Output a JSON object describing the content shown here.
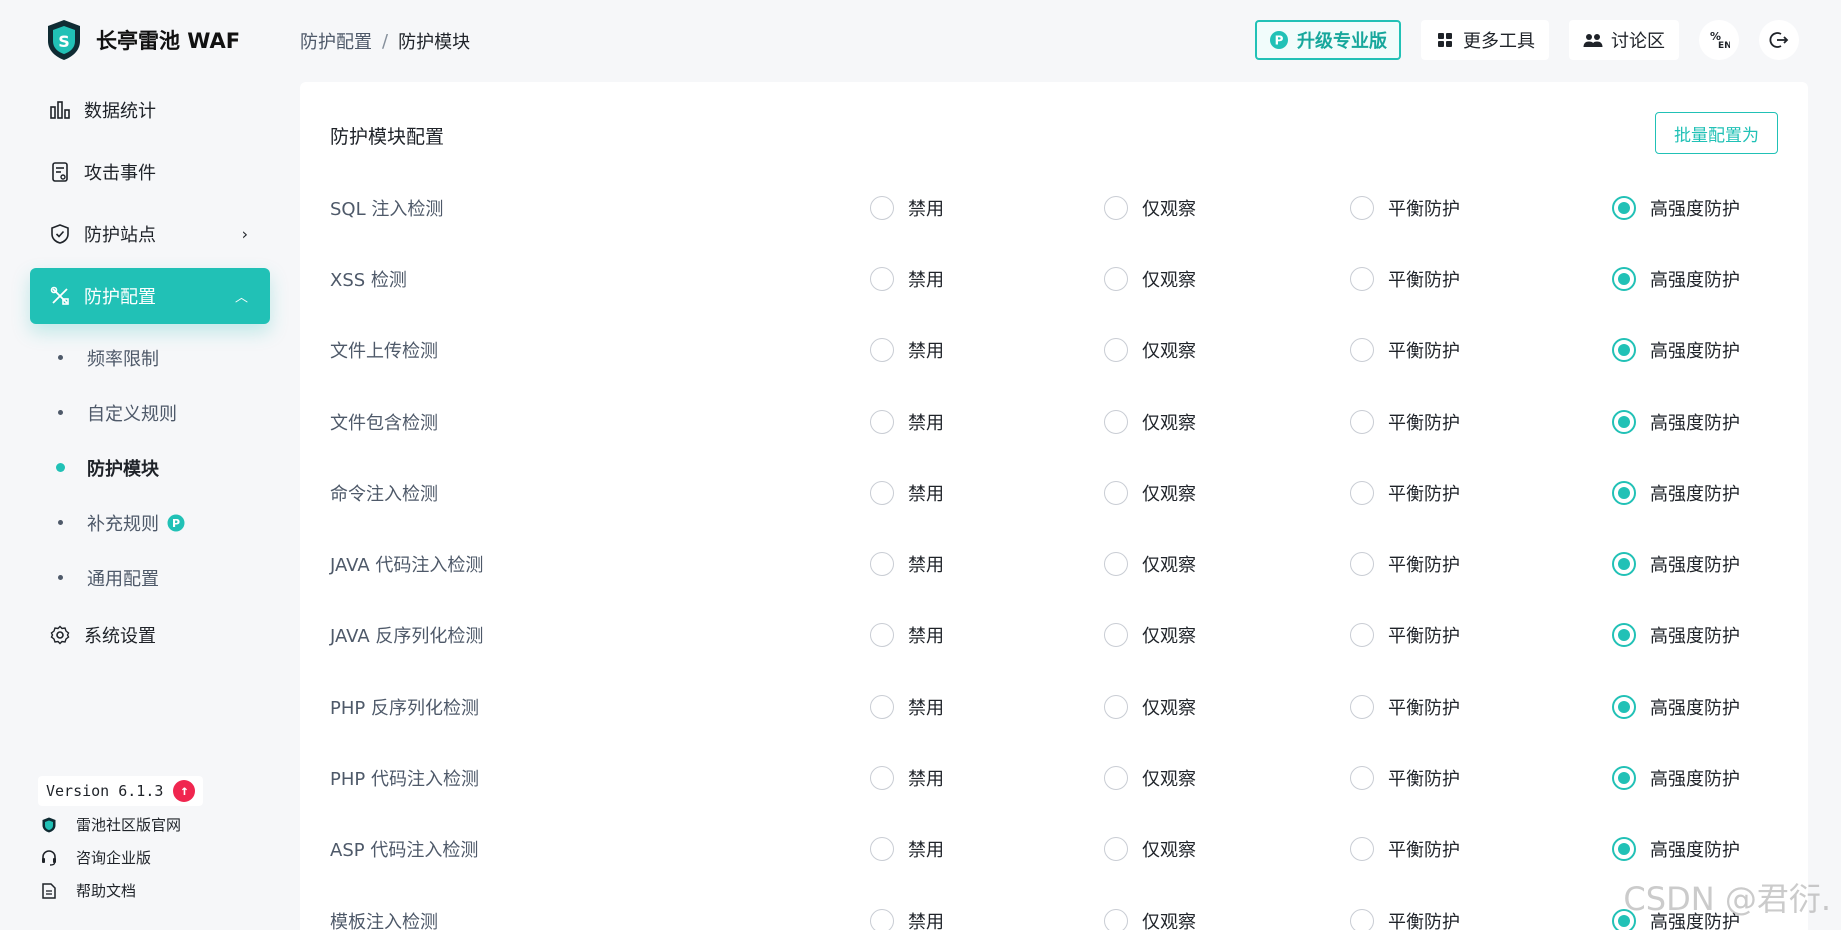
{
  "app": {
    "name": "长亭雷池 WAF"
  },
  "colors": {
    "accent": "#21c1b6",
    "alert": "#f0264f"
  },
  "sidebar": {
    "items": [
      {
        "label": "数据统计",
        "icon": "bar-chart-icon"
      },
      {
        "label": "攻击事件",
        "icon": "document-icon"
      },
      {
        "label": "防护站点",
        "icon": "shield-icon"
      },
      {
        "label": "防护配置",
        "icon": "tools-icon"
      }
    ],
    "subitems": [
      {
        "label": "频率限制"
      },
      {
        "label": "自定义规则"
      },
      {
        "label": "防护模块"
      },
      {
        "label": "补充规则"
      },
      {
        "label": "通用配置"
      }
    ],
    "settings": {
      "label": "系统设置",
      "icon": "gear-icon"
    },
    "version": "Version 6.1.3",
    "update_badge": "↑",
    "links": [
      {
        "label": "雷池社区版官网",
        "icon": "shield-logo-icon"
      },
      {
        "label": "咨询企业版",
        "icon": "headset-icon"
      },
      {
        "label": "帮助文档",
        "icon": "doc-icon"
      }
    ]
  },
  "breadcrumb": {
    "parent": "防护配置",
    "sep": "/",
    "current": "防护模块"
  },
  "header": {
    "upgrade": "升级专业版",
    "tools": "更多工具",
    "forum": "讨论区",
    "lang_icon": "language-icon",
    "logout_icon": "logout-icon"
  },
  "main": {
    "title": "防护模块配置",
    "batch_button": "批量配置为",
    "options": [
      "禁用",
      "仅观察",
      "平衡防护",
      "高强度防护"
    ],
    "rows": [
      {
        "label": "SQL 注入检测",
        "selected": 3
      },
      {
        "label": "XSS 检测",
        "selected": 3
      },
      {
        "label": "文件上传检测",
        "selected": 3
      },
      {
        "label": "文件包含检测",
        "selected": 3
      },
      {
        "label": "命令注入检测",
        "selected": 3
      },
      {
        "label": "JAVA 代码注入检测",
        "selected": 3
      },
      {
        "label": "JAVA 反序列化检测",
        "selected": 3
      },
      {
        "label": "PHP 反序列化检测",
        "selected": 3
      },
      {
        "label": "PHP 代码注入检测",
        "selected": 3
      },
      {
        "label": "ASP 代码注入检测",
        "selected": 3
      },
      {
        "label": "模板注入检测",
        "selected": 3
      }
    ]
  },
  "watermark": "CSDN @君衍."
}
